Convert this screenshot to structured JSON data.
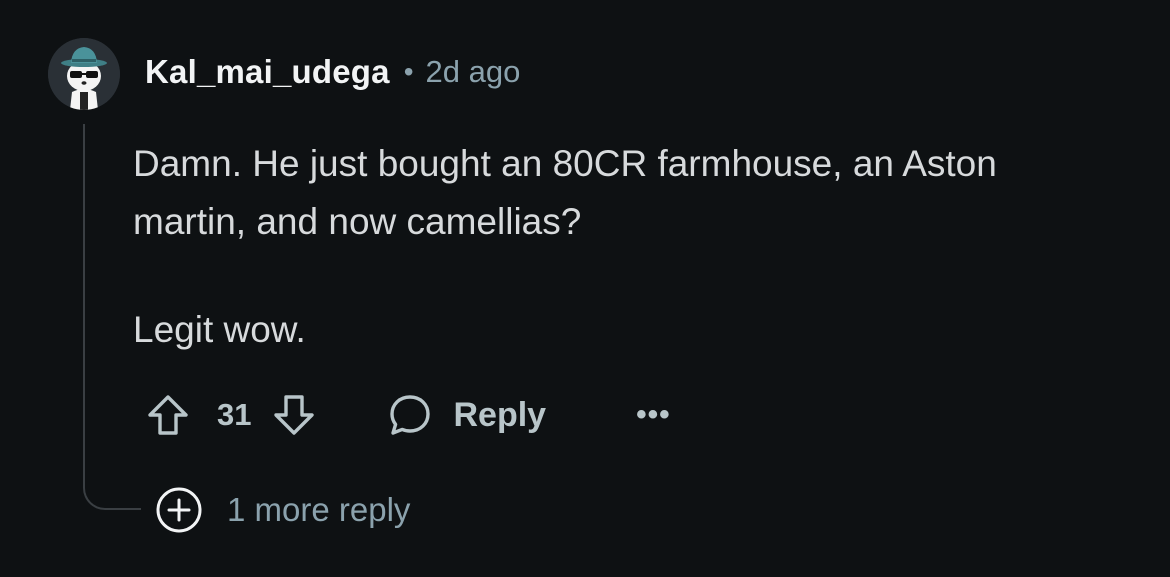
{
  "comment": {
    "author": "Kal_mai_udega",
    "separator": "•",
    "time": "2d ago",
    "body": [
      "Damn. He just bought an 80CR farmhouse, an Aston martin, and now camellias?",
      "Legit wow."
    ],
    "score": "31",
    "reply_label": "Reply",
    "more_label": "•••",
    "more_replies_label": "1 more reply"
  },
  "icons": {
    "avatar": "panda-avatar-with-hat-and-sunglasses",
    "upvote": "arrow-up-outline-icon",
    "downvote": "arrow-down-outline-icon",
    "reply": "speech-bubble-icon",
    "more": "ellipsis-icon",
    "expand": "plus-circle-icon"
  },
  "colors": {
    "background": "#0e1113",
    "author": "#f2f4f5",
    "meta": "#8ba2ad",
    "body_text": "#d7dadc",
    "action": "#b8c5c9",
    "thread_line": "#3a3f43"
  }
}
